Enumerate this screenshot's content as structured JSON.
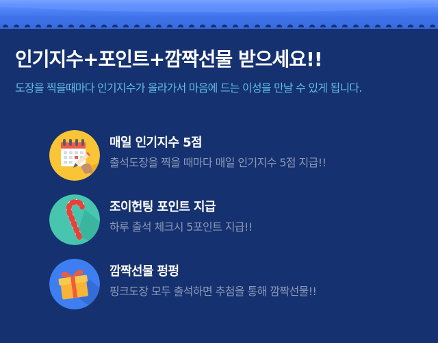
{
  "colors": {
    "background": "#16316f",
    "banner": "#3f72ea",
    "headline": "#ffffff",
    "subline": "#5fbde8",
    "description": "#8b99b8"
  },
  "header": {
    "title": "인기지수+포인트+깜짝선물 받으세요!!",
    "subtitle": "도장을 찍을때마다 인기지수가 올라가서 마음에 드는 이성을 만날 수 있게 됩니다."
  },
  "features": [
    {
      "icon": "calendar-icon",
      "icon_color": "#f9c436",
      "title": "매일 인기지수 5점",
      "description": "출석도장을 찍을 때마다 매일 인기지수 5점 지급!!"
    },
    {
      "icon": "candy-cane-icon",
      "icon_color": "#47c5af",
      "title": "조이헌팅 포인트 지급",
      "description": "하루 출석 체크시 5포인트 지급!!"
    },
    {
      "icon": "gift-box-icon",
      "icon_color": "#3f7ef0",
      "title": "깜짝선물 펑펑",
      "description": "핑크도장 모두 출석하면 추첨을 통해 깜짝선물!!"
    }
  ]
}
